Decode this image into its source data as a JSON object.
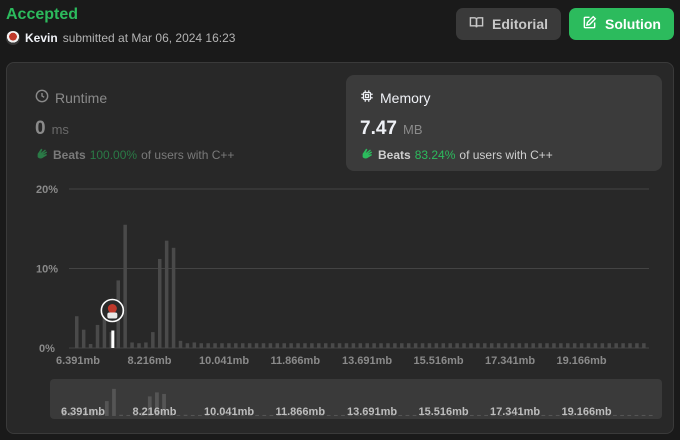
{
  "header": {
    "status": "Accepted",
    "user": "Kevin",
    "submitted_text": "submitted at Mar 06, 2024 16:23",
    "editorial_label": "Editorial",
    "solution_label": "Solution"
  },
  "runtime": {
    "title": "Runtime",
    "value": "0",
    "unit": "ms",
    "beats_word": "Beats",
    "beats_pct": "100.00%",
    "beats_suffix": "of users with C++"
  },
  "memory": {
    "title": "Memory",
    "value": "7.47",
    "unit": "MB",
    "beats_word": "Beats",
    "beats_pct": "83.24%",
    "beats_suffix": "of users with C++"
  },
  "colors": {
    "accent": "#2cbb5d",
    "bar": "#4a4a4a",
    "highlight": "#ffffff"
  },
  "chart_data": {
    "type": "bar",
    "title": "",
    "xlabel": "",
    "ylabel": "",
    "y_ticks": [
      "20%",
      "10%",
      "0%"
    ],
    "ylim": [
      0,
      20
    ],
    "x_tick_labels": [
      "6.391mb",
      "8.216mb",
      "10.041mb",
      "11.866mb",
      "13.691mb",
      "15.516mb",
      "17.341mb",
      "19.166mb"
    ],
    "values": [
      4.0,
      2.3,
      0.5,
      2.9,
      3.8,
      2.0,
      8.5,
      15.5,
      0.7,
      0.6,
      0.7,
      2.0,
      11.2,
      13.5,
      12.6,
      0.9,
      0.6,
      0.7,
      0.6,
      0.6,
      0.6,
      0.6,
      0.6,
      0.6,
      0.6,
      0.6,
      0.6,
      0.6,
      0.6,
      0.6,
      0.6,
      0.6,
      0.6,
      0.6,
      0.6,
      0.6,
      0.6,
      0.6,
      0.6,
      0.6,
      0.6,
      0.6,
      0.6,
      0.6,
      0.6,
      0.6,
      0.6,
      0.6,
      0.6,
      0.6,
      0.6,
      0.6,
      0.6,
      0.6,
      0.6,
      0.6,
      0.6,
      0.6,
      0.6,
      0.6,
      0.6,
      0.6,
      0.6,
      0.6,
      0.6,
      0.6,
      0.6,
      0.6,
      0.6,
      0.6,
      0.6,
      0.6,
      0.6,
      0.6,
      0.6,
      0.6,
      0.6,
      0.6,
      0.6,
      0.6,
      0.6,
      0.6,
      0.6
    ],
    "highlight_index": 5,
    "highlight_value": 2.2,
    "grid": true
  }
}
